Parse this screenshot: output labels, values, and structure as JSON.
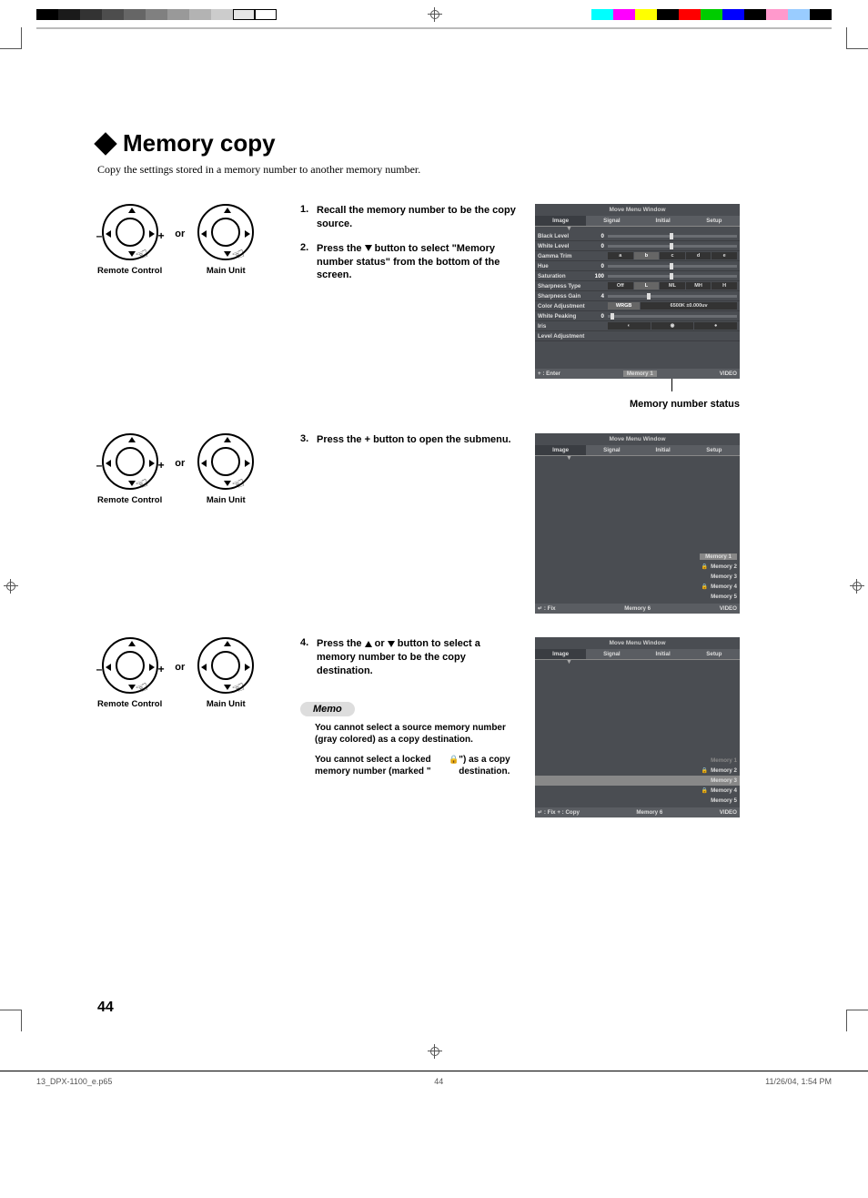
{
  "title": "Memory copy",
  "intro": "Copy the settings stored in a memory number to another memory number.",
  "controls": {
    "remote": "Remote Control",
    "main": "Main Unit",
    "or": "or"
  },
  "steps": {
    "s1": {
      "num": "1.",
      "text": "Recall the memory number to be the copy source."
    },
    "s2": {
      "num": "2.",
      "text_a": "Press the ",
      "text_b": " button to select \"Memory number status\" from the bottom of the screen."
    },
    "s3": {
      "num": "3.",
      "text": "Press the + button to open the submenu."
    },
    "s4": {
      "num": "4.",
      "text_a": "Press the ",
      "text_b": " or ",
      "text_c": " button to select a memory number to be the copy destination."
    }
  },
  "memo": {
    "header": "Memo",
    "m1": "You cannot select a source memory number (gray colored) as a copy destination.",
    "m2_a": "You cannot select a locked memory number (marked \"",
    "m2_b": "\") as a copy destination."
  },
  "osd": {
    "title": "Move Menu Window",
    "tabs": {
      "t1": "Image",
      "t2": "Signal",
      "t3": "Initial",
      "t4": "Setup"
    },
    "rows": {
      "black": {
        "lbl": "Black Level",
        "val": "0"
      },
      "white": {
        "lbl": "White Level",
        "val": "0"
      },
      "gamma": {
        "lbl": "Gamma Trim",
        "opts": [
          "a",
          "b",
          "c",
          "d",
          "e"
        ]
      },
      "hue": {
        "lbl": "Hue",
        "val": "0"
      },
      "sat": {
        "lbl": "Saturation",
        "val": "100"
      },
      "sharpT": {
        "lbl": "Sharpness Type",
        "opts": [
          "Off",
          "L",
          "ML",
          "MH",
          "H"
        ]
      },
      "sharpG": {
        "lbl": "Sharpness Gain",
        "val": "4"
      },
      "color": {
        "lbl": "Color Adjustment",
        "left": "WRGB",
        "right": "6500K ±0.000uv"
      },
      "peak": {
        "lbl": "White Peaking",
        "val": "0"
      },
      "iris": {
        "lbl": "Iris"
      },
      "level": {
        "lbl": "Level Adjustment"
      }
    },
    "foot1": {
      "left": "+ : Enter",
      "mid": "Memory 1",
      "right": "VIDEO"
    },
    "foot2": {
      "left": "↵ : Fix",
      "mid": "Memory 6",
      "right": "VIDEO"
    },
    "foot3": {
      "left": "↵ : Fix    + : Copy",
      "mid": "Memory 6",
      "right": "VIDEO"
    },
    "caption1": "Memory number status",
    "mems": {
      "m1": "Memory 1",
      "m2": "Memory 2",
      "m3": "Memory 3",
      "m4": "Memory 4",
      "m5": "Memory 5",
      "m6": "Memory 6"
    }
  },
  "page_num": "44",
  "footer": {
    "file": "13_DPX-1100_e.p65",
    "page": "44",
    "date": "11/26/04, 1:54 PM"
  }
}
